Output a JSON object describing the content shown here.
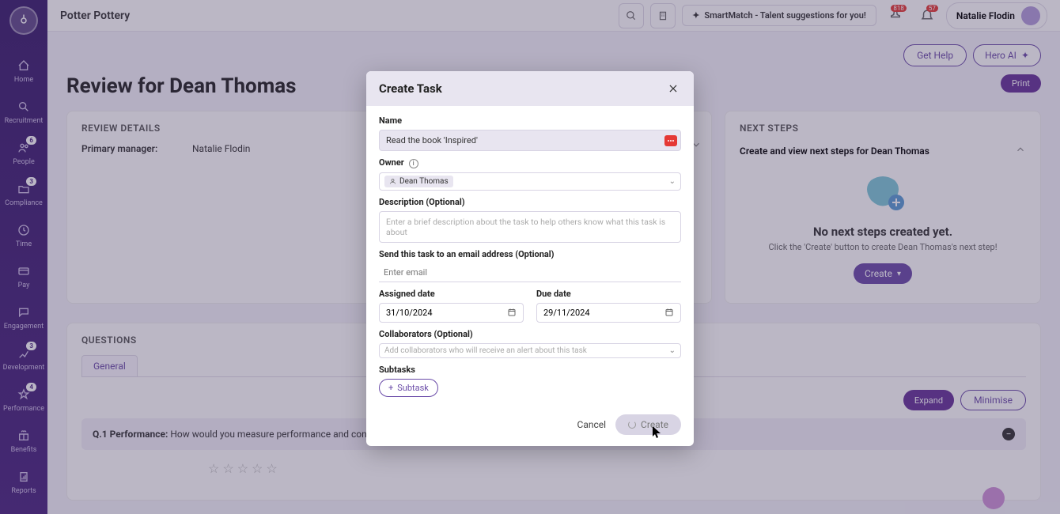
{
  "app": {
    "title": "Potter Pottery"
  },
  "sidebar": {
    "items": [
      {
        "label": "Home",
        "badge": null
      },
      {
        "label": "Recruitment",
        "badge": null
      },
      {
        "label": "People",
        "badge": "6"
      },
      {
        "label": "Compliance",
        "badge": "3"
      },
      {
        "label": "Time",
        "badge": null
      },
      {
        "label": "Pay",
        "badge": null
      },
      {
        "label": "Engagement",
        "badge": null
      },
      {
        "label": "Development",
        "badge": "3"
      },
      {
        "label": "Performance",
        "badge": "4"
      },
      {
        "label": "Benefits",
        "badge": null
      },
      {
        "label": "Reports",
        "badge": null
      }
    ]
  },
  "topbar": {
    "smartmatch": "SmartMatch - Talent suggestions for you!",
    "badge1": "818",
    "badge2": "57",
    "user": "Natalie Flodin"
  },
  "toolbar": {
    "help": "Get Help",
    "hero": "Hero AI",
    "print": "Print"
  },
  "page": {
    "title": "Review for Dean Thomas",
    "review_details_header": "REVIEW DETAILS",
    "primary_manager_label": "Primary manager:",
    "primary_manager_value": "Natalie Flodin",
    "next_steps_header": "NEXT STEPS",
    "next_steps_subtitle": "Create and view next steps for Dean Thomas",
    "empty_title": "No next steps created yet.",
    "empty_sub": "Click the 'Create' button to create Dean Thomas's next step!",
    "create_btn": "Create",
    "questions_header": "QUESTIONS",
    "tab_general": "General",
    "expand": "Expand",
    "minimise": "Minimise",
    "q1_prefix": "Q.1 Performance:",
    "q1_text": " How would you measure performance and contribution in regards to key responsibilities and accountabilities?"
  },
  "modal": {
    "title": "Create Task",
    "name_label": "Name",
    "name_value": "Read the book 'Inspired'",
    "owner_label": "Owner",
    "owner_value": "Dean Thomas",
    "desc_label": "Description (Optional)",
    "desc_placeholder": "Enter a brief description about the task to help others know what this task is about",
    "email_label": "Send this task to an email address (Optional)",
    "email_placeholder": "Enter email",
    "assigned_label": "Assigned date",
    "assigned_value": "31/10/2024",
    "due_label": "Due date",
    "due_value": "29/11/2024",
    "collab_label": "Collaborators (Optional)",
    "collab_placeholder": "Add collaborators who will receive an alert about this task",
    "subtasks_label": "Subtasks",
    "subtask_btn": "Subtask",
    "cancel": "Cancel",
    "create": "Create"
  }
}
